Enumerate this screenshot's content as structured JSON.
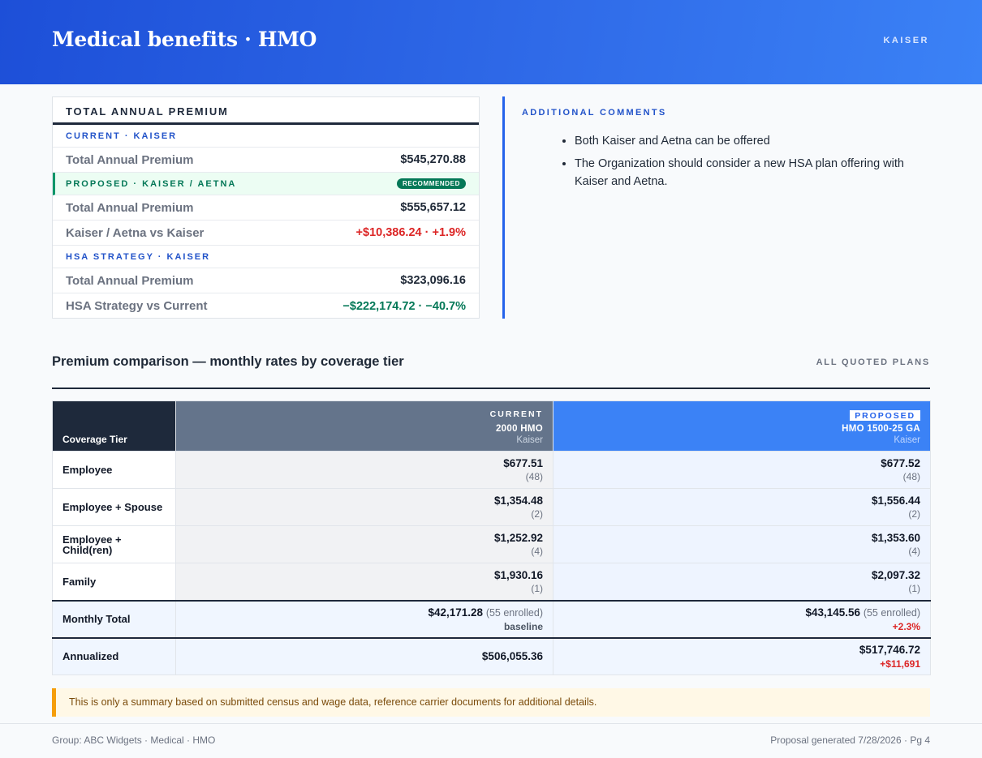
{
  "header": {
    "title": "Medical benefits · HMO",
    "carrier": "KAISER"
  },
  "premium": {
    "title": "TOTAL ANNUAL PREMIUM",
    "current_label": "CURRENT · KAISER",
    "current_total_label": "Total Annual Premium",
    "current_total": "$545,270.88",
    "proposed_label": "PROPOSED · KAISER / AETNA",
    "proposed_badge": "RECOMMENDED",
    "proposed_total_label": "Total Annual Premium",
    "proposed_total": "$555,657.12",
    "proposed_delta_label": "Kaiser / Aetna vs Kaiser",
    "proposed_delta": "+$10,386.24 · +1.9%",
    "hsa_label": "HSA STRATEGY · KAISER",
    "hsa_total_label": "Total Annual Premium",
    "hsa_total": "$323,096.16",
    "hsa_delta_label": "HSA Strategy vs Current",
    "hsa_delta": "−$222,174.72 · −40.7%",
    "colors": {
      "increase": "#dc2626",
      "decrease": "#047857"
    }
  },
  "comments": {
    "title": "ADDITIONAL COMMENTS",
    "items": [
      "Both Kaiser and Aetna can be offered",
      "The Organization should consider a new HSA plan offering with Kaiser and Aetna."
    ]
  },
  "comparison": {
    "title": "Premium comparison — monthly rates by coverage tier",
    "right_label": "ALL QUOTED PLANS",
    "tier_header": "Coverage Tier",
    "current": {
      "label": "CURRENT",
      "plan": "2000 HMO",
      "carrier": "Kaiser"
    },
    "proposed": {
      "label": "PROPOSED",
      "plan": "HMO 1500-25 GA",
      "carrier": "Kaiser"
    },
    "rows": [
      {
        "tier": "Employee",
        "current": "$677.51",
        "current_count": "(48)",
        "proposed": "$677.52",
        "proposed_count": "(48)"
      },
      {
        "tier": "Employee + Spouse",
        "current": "$1,354.48",
        "current_count": "(2)",
        "proposed": "$1,556.44",
        "proposed_count": "(2)"
      },
      {
        "tier": "Employee + Child(ren)",
        "current": "$1,252.92",
        "current_count": "(4)",
        "proposed": "$1,353.60",
        "proposed_count": "(4)"
      },
      {
        "tier": "Family",
        "current": "$1,930.16",
        "current_count": "(1)",
        "proposed": "$2,097.32",
        "proposed_count": "(1)"
      }
    ],
    "monthly": {
      "label": "Monthly Total",
      "current": "$42,171.28",
      "current_enrolled": "(55 enrolled)",
      "current_sub": "baseline",
      "proposed": "$43,145.56",
      "proposed_enrolled": "(55 enrolled)",
      "proposed_sub": "+2.3%"
    },
    "annual": {
      "label": "Annualized",
      "current": "$506,055.36",
      "proposed": "$517,746.72",
      "proposed_sub": "+$11,691"
    }
  },
  "note": "This is only a summary based on submitted census and wage data, reference carrier documents for additional details.",
  "footer": {
    "left": "Group: ABC Widgets · Medical · HMO",
    "right": "Proposal generated 7/28/2026 · Pg 4"
  }
}
